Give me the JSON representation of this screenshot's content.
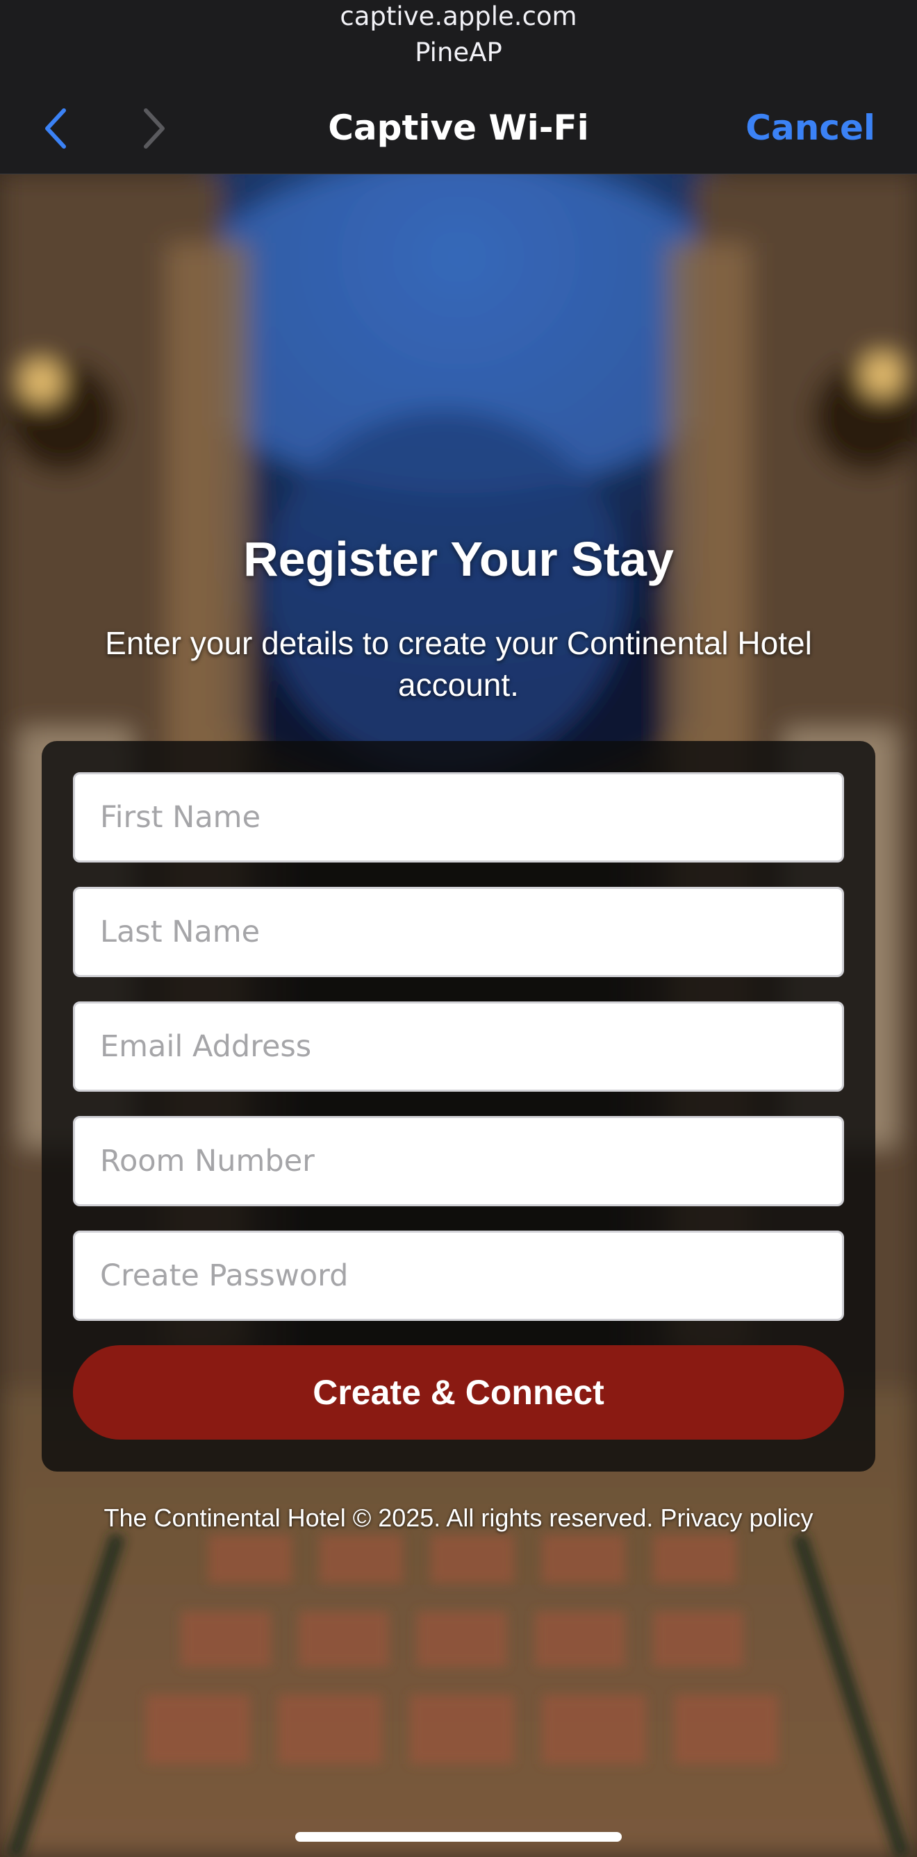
{
  "browser": {
    "url_host": "captive.apple.com",
    "network_name": "PineAP",
    "title": "Captive Wi-Fi",
    "cancel_label": "Cancel",
    "accent_color": "#3b82f6"
  },
  "page": {
    "heading": "Register Your Stay",
    "subheading": "Enter your details to create your Continental Hotel account.",
    "form": {
      "fields": [
        {
          "placeholder": "First Name",
          "value": ""
        },
        {
          "placeholder": "Last Name",
          "value": ""
        },
        {
          "placeholder": "Email Address",
          "value": ""
        },
        {
          "placeholder": "Room Number",
          "value": ""
        },
        {
          "placeholder": "Create Password",
          "value": ""
        }
      ],
      "submit_label": "Create & Connect",
      "submit_color": "#8a1a12"
    },
    "footer": {
      "copyright": "The Continental Hotel © 2025. All rights reserved.",
      "privacy_link": "Privacy policy"
    }
  },
  "icons": {
    "back": "chevron-left-icon",
    "forward": "chevron-right-icon"
  }
}
